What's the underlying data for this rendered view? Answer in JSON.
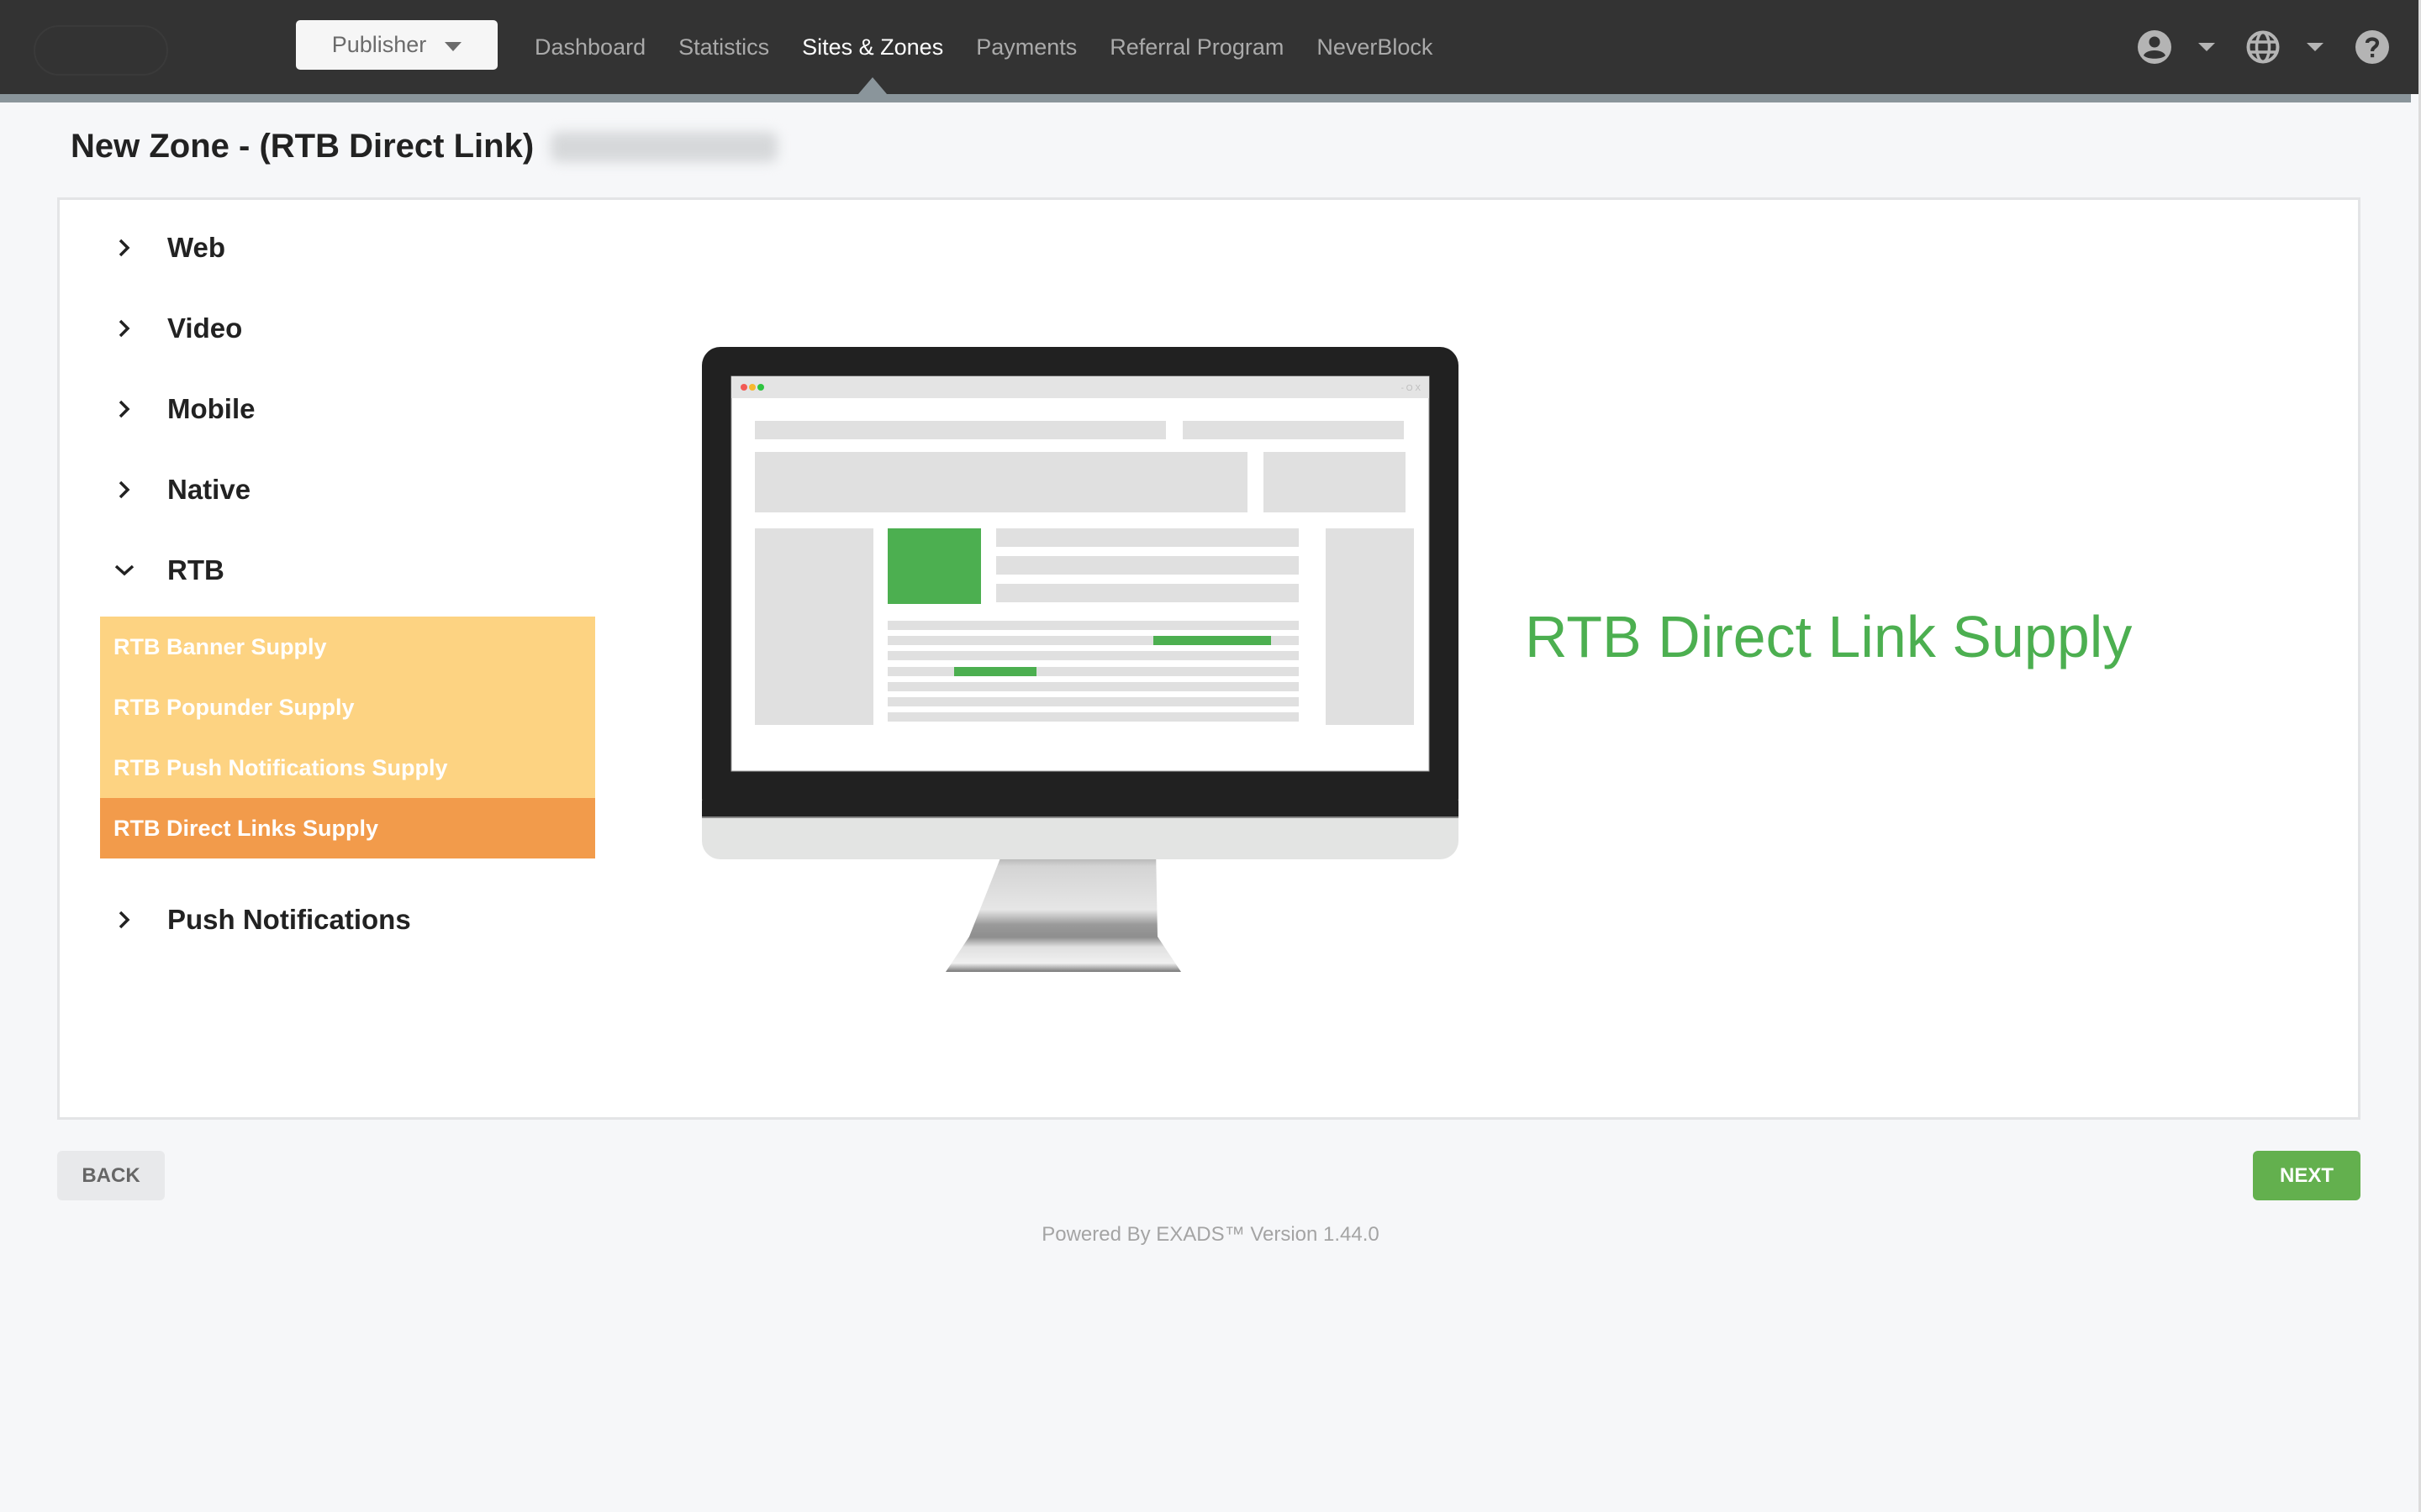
{
  "navbar": {
    "role_selector": {
      "label": "Publisher"
    },
    "links": [
      {
        "label": "Dashboard",
        "active": false
      },
      {
        "label": "Statistics",
        "active": false
      },
      {
        "label": "Sites & Zones",
        "active": true
      },
      {
        "label": "Payments",
        "active": false
      },
      {
        "label": "Referral Program",
        "active": false
      },
      {
        "label": "NeverBlock",
        "active": false
      }
    ],
    "icons": [
      "account-icon",
      "globe-icon",
      "help-icon"
    ]
  },
  "page": {
    "title": "New Zone - (RTB Direct Link)",
    "site_name_blurred": true
  },
  "categories": [
    {
      "label": "Web",
      "expanded": false
    },
    {
      "label": "Video",
      "expanded": false
    },
    {
      "label": "Mobile",
      "expanded": false
    },
    {
      "label": "Native",
      "expanded": false
    },
    {
      "label": "RTB",
      "expanded": true,
      "items": [
        {
          "label": "RTB Banner Supply",
          "selected": false
        },
        {
          "label": "RTB Popunder Supply",
          "selected": false
        },
        {
          "label": "RTB Push Notifications Supply",
          "selected": false
        },
        {
          "label": "RTB Direct Links Supply",
          "selected": true
        }
      ]
    },
    {
      "label": "Push Notifications",
      "expanded": false
    }
  ],
  "preview": {
    "heading": "RTB Direct Link Supply",
    "window_controls_text": "- O X"
  },
  "actions": {
    "back_label": "BACK",
    "next_label": "NEXT"
  },
  "footer": {
    "text": "Powered By EXADS™ Version 1.44.0"
  },
  "colors": {
    "navbar_bg": "#333333",
    "nav_strip": "#8a959b",
    "accent_green": "#4caf50",
    "next_button": "#63b04e",
    "submenu_bg": "#fdd382",
    "submenu_selected": "#f29b4b"
  }
}
